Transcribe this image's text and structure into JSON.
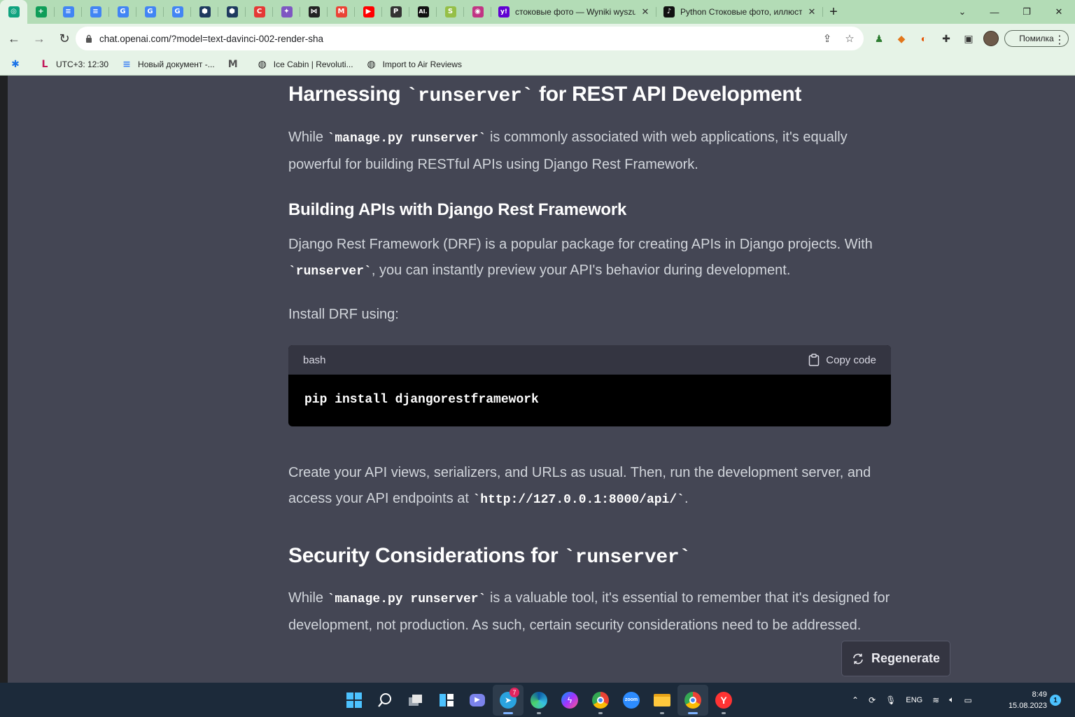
{
  "browser": {
    "pinned_tabs": [
      {
        "icon": "chatgpt-icon",
        "color": "#10a37f",
        "glyph": "◎"
      },
      {
        "icon": "google-sheets-icon",
        "color": "#0f9d58",
        "glyph": "+"
      },
      {
        "icon": "google-docs-icon",
        "color": "#4285f4",
        "glyph": "≡"
      },
      {
        "icon": "google-docs-icon",
        "color": "#4285f4",
        "glyph": "≡"
      },
      {
        "icon": "google-translate-icon",
        "color": "#4285f4",
        "glyph": "G"
      },
      {
        "icon": "google-translate-icon",
        "color": "#4285f4",
        "glyph": "G"
      },
      {
        "icon": "google-translate-icon",
        "color": "#4285f4",
        "glyph": "G"
      },
      {
        "icon": "hexagon-icon",
        "color": "#1e3a5f",
        "glyph": "⬢"
      },
      {
        "icon": "hexagon-icon",
        "color": "#1e3a5f",
        "glyph": "⬢"
      },
      {
        "icon": "copyleaks-icon",
        "color": "#e53935",
        "glyph": "C"
      },
      {
        "icon": "sparkle-icon",
        "color": "#7e57c2",
        "glyph": "✦"
      },
      {
        "icon": "bowtie-icon",
        "color": "#222222",
        "glyph": "⋈"
      },
      {
        "icon": "gmail-icon",
        "color": "#ea4335",
        "glyph": "M"
      },
      {
        "icon": "youtube-icon",
        "color": "#ff0000",
        "glyph": "▶"
      },
      {
        "icon": "p-logo-icon",
        "color": "#333333",
        "glyph": "P"
      },
      {
        "icon": "ai-logo-icon",
        "color": "#111111",
        "glyph": "AI."
      },
      {
        "icon": "shopify-icon",
        "color": "#95bf47",
        "glyph": "S"
      },
      {
        "icon": "circle-logo-icon",
        "color": "#c13584",
        "glyph": "◉"
      }
    ],
    "tabs": [
      {
        "title": "стоковые фото — Wyniki wyszuk",
        "icon": "yahoo-icon",
        "color": "#6001d2",
        "glyph": "y!"
      },
      {
        "title": "Python Стоковые фото, иллюстр",
        "icon": "tiktok-icon",
        "color": "#111111",
        "glyph": "♪"
      }
    ],
    "url": "chat.openai.com/?model=text-davinci-002-render-sha",
    "profile_label": "Помилка",
    "bookmarks": [
      {
        "label": "",
        "icon": "settings-gear-icon",
        "color": "#1a73e8",
        "glyph": "✱"
      },
      {
        "label": "UTC+3: 12:30",
        "icon": "clock-icon",
        "color": "#c2185b",
        "glyph": "L"
      },
      {
        "label": "Новый документ -...",
        "icon": "google-docs-icon",
        "color": "#4285f4",
        "glyph": "≡"
      },
      {
        "label": "",
        "icon": "m-logo-icon",
        "color": "#555555",
        "glyph": "M"
      },
      {
        "label": "Ice Cabin | Revoluti...",
        "icon": "globe-icon",
        "color": "#222222",
        "glyph": "◍"
      },
      {
        "label": "Import to Air Reviews",
        "icon": "globe-icon",
        "color": "#222222",
        "glyph": "◍"
      }
    ]
  },
  "article": {
    "h_rest_pre": "Harnessing ",
    "h_rest_code": "`runserver`",
    "h_rest_post": " for REST API Development",
    "p1_pre": "While ",
    "p1_code": "`manage.py runserver`",
    "p1_post": " is commonly associated with web applications, it's equally powerful for building RESTful APIs using Django Rest Framework.",
    "h_drf": "Building APIs with Django Rest Framework",
    "p2_pre": "Django Rest Framework (DRF) is a popular package for creating APIs in Django projects. With ",
    "p2_code": "`runserver`",
    "p2_post": ", you can instantly preview your API's behavior during development.",
    "p3": "Install DRF using:",
    "code_lang": "bash",
    "copy_label": "Copy code",
    "code": "pip install djangorestframework",
    "p4_pre": "Create your API views, serializers, and URLs as usual. Then, run the development server, and access your API endpoints at ",
    "p4_code": "`http://127.0.0.1:8000/api/`",
    "p4_post": ".",
    "h_sec_pre": "Security Considerations for ",
    "h_sec_code": "`runserver`",
    "p5_pre": "While ",
    "p5_code": "`manage.py runserver`",
    "p5_post": " is a valuable tool, it's essential to remember that it's designed for development, not production. As such, certain security considerations need to be addressed."
  },
  "regenerate_label": "Regenerate",
  "taskbar": {
    "telegram_badge": "7",
    "lang": "ENG",
    "time": "8:49",
    "date": "15.08.2023",
    "notifications": "1"
  }
}
